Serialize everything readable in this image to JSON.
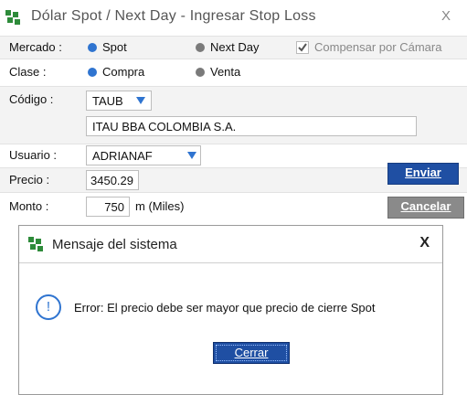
{
  "window": {
    "title": "Dólar Spot / Next Day - Ingresar Stop Loss",
    "close": "X"
  },
  "form": {
    "mercado": {
      "label": "Mercado :",
      "options": [
        "Spot",
        "Next Day"
      ],
      "selected": "Spot",
      "compensar_label": "Compensar por Cámara",
      "compensar_checked": true
    },
    "clase": {
      "label": "Clase :",
      "options": [
        "Compra",
        "Venta"
      ],
      "selected": "Compra"
    },
    "codigo": {
      "label": "Código :",
      "value": "TAUB",
      "description": "ITAU BBA COLOMBIA S.A."
    },
    "usuario": {
      "label": "Usuario :",
      "value": "ADRIANAF"
    },
    "precio": {
      "label": "Precio :",
      "value": "3450.29"
    },
    "monto": {
      "label": "Monto :",
      "value": "750",
      "unit": "m (Miles)"
    }
  },
  "buttons": {
    "enviar": "Enviar",
    "cancelar": "Cancelar"
  },
  "dialog": {
    "title": "Mensaje del sistema",
    "close": "X",
    "icon": "info-icon",
    "message": "Error: El precio debe ser mayor que precio de cierre Spot",
    "cerrar": "Cerrar"
  },
  "colors": {
    "accent": "#2f74d0",
    "primary_button": "#1f4fa3",
    "secondary_button": "#8a8a8a",
    "logo_green": "#2e8b3a"
  }
}
